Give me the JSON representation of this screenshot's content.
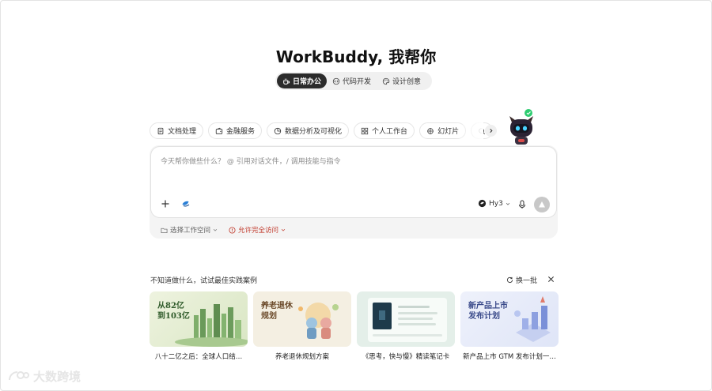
{
  "header": {
    "title": "WorkBuddy, 我帮你"
  },
  "modes": [
    {
      "label": "日常办公",
      "icon": "coffee-icon",
      "active": true
    },
    {
      "label": "代码开发",
      "icon": "code-icon",
      "active": false
    },
    {
      "label": "设计创意",
      "icon": "palette-icon",
      "active": false
    }
  ],
  "chips": [
    {
      "label": "文档处理",
      "icon": "document-icon"
    },
    {
      "label": "金融服务",
      "icon": "wallet-icon"
    },
    {
      "label": "数据分析及可视化",
      "icon": "pie-chart-icon"
    },
    {
      "label": "个人工作台",
      "icon": "grid-icon"
    },
    {
      "label": "幻灯片",
      "icon": "slides-icon"
    }
  ],
  "composer": {
    "placeholder": "今天帮你做些什么？ @ 引用对话文件，/ 调用技能与指令",
    "model": "Hy3"
  },
  "options": {
    "workspace": "选择工作空间",
    "access": "允许完全访问"
  },
  "suggestions": {
    "label": "不知道做什么，试试最佳实践案例",
    "refresh": "换一批",
    "cards": [
      {
        "caption": "八十二亿之后：全球人口结…",
        "thumb_title_1": "从82亿",
        "thumb_title_2": "到103亿"
      },
      {
        "caption": "养老退休规划方案",
        "thumb_title_1": "养老退休",
        "thumb_title_2": "规划"
      },
      {
        "caption": "《思考，快与慢》精读笔记卡",
        "thumb_title_1": "",
        "thumb_title_2": ""
      },
      {
        "caption": "新产品上市 GTM 发布计划一…",
        "thumb_title_1": "新产品上市",
        "thumb_title_2": "发布计划"
      }
    ]
  },
  "watermark": {
    "text": "大数跨境"
  },
  "colors": {
    "accent_dark": "#2b2b2b",
    "warn": "#c0392b",
    "robot_badge": "#2ecc71"
  }
}
